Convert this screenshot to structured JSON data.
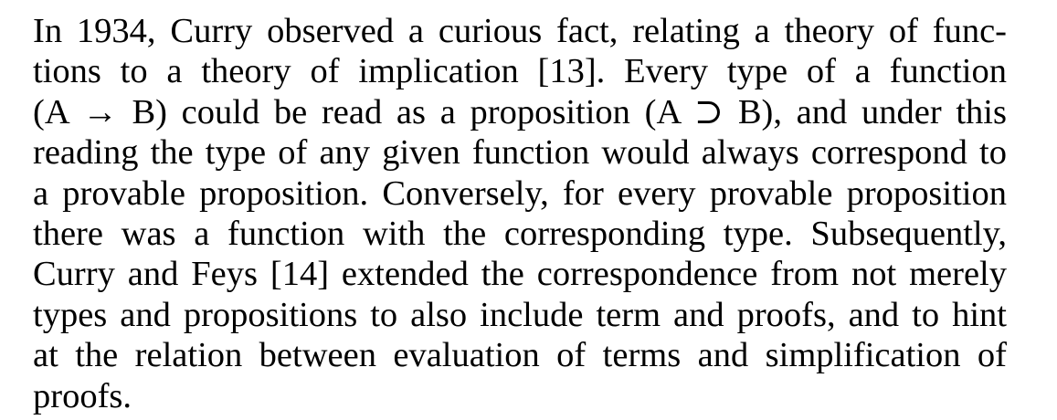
{
  "paragraph": {
    "lines": [
      "In 1934, Curry observed a curious fact, relating a theory of func-",
      "tions to a theory of implication [13]. Every type of a function",
      "(A → B) could be read as a proposition (A ⊃ B), and under this",
      "reading the type of any given function would always correspond to",
      "a provable proposition. Conversely, for every provable proposition",
      "there was a function with the corresponding type. Subsequently,",
      "Curry and Feys [14] extended the correspondence from not merely",
      "types and propositions to also include term and proofs, and to hint",
      "at the relation between evaluation of terms and simplification of",
      "proofs."
    ]
  }
}
